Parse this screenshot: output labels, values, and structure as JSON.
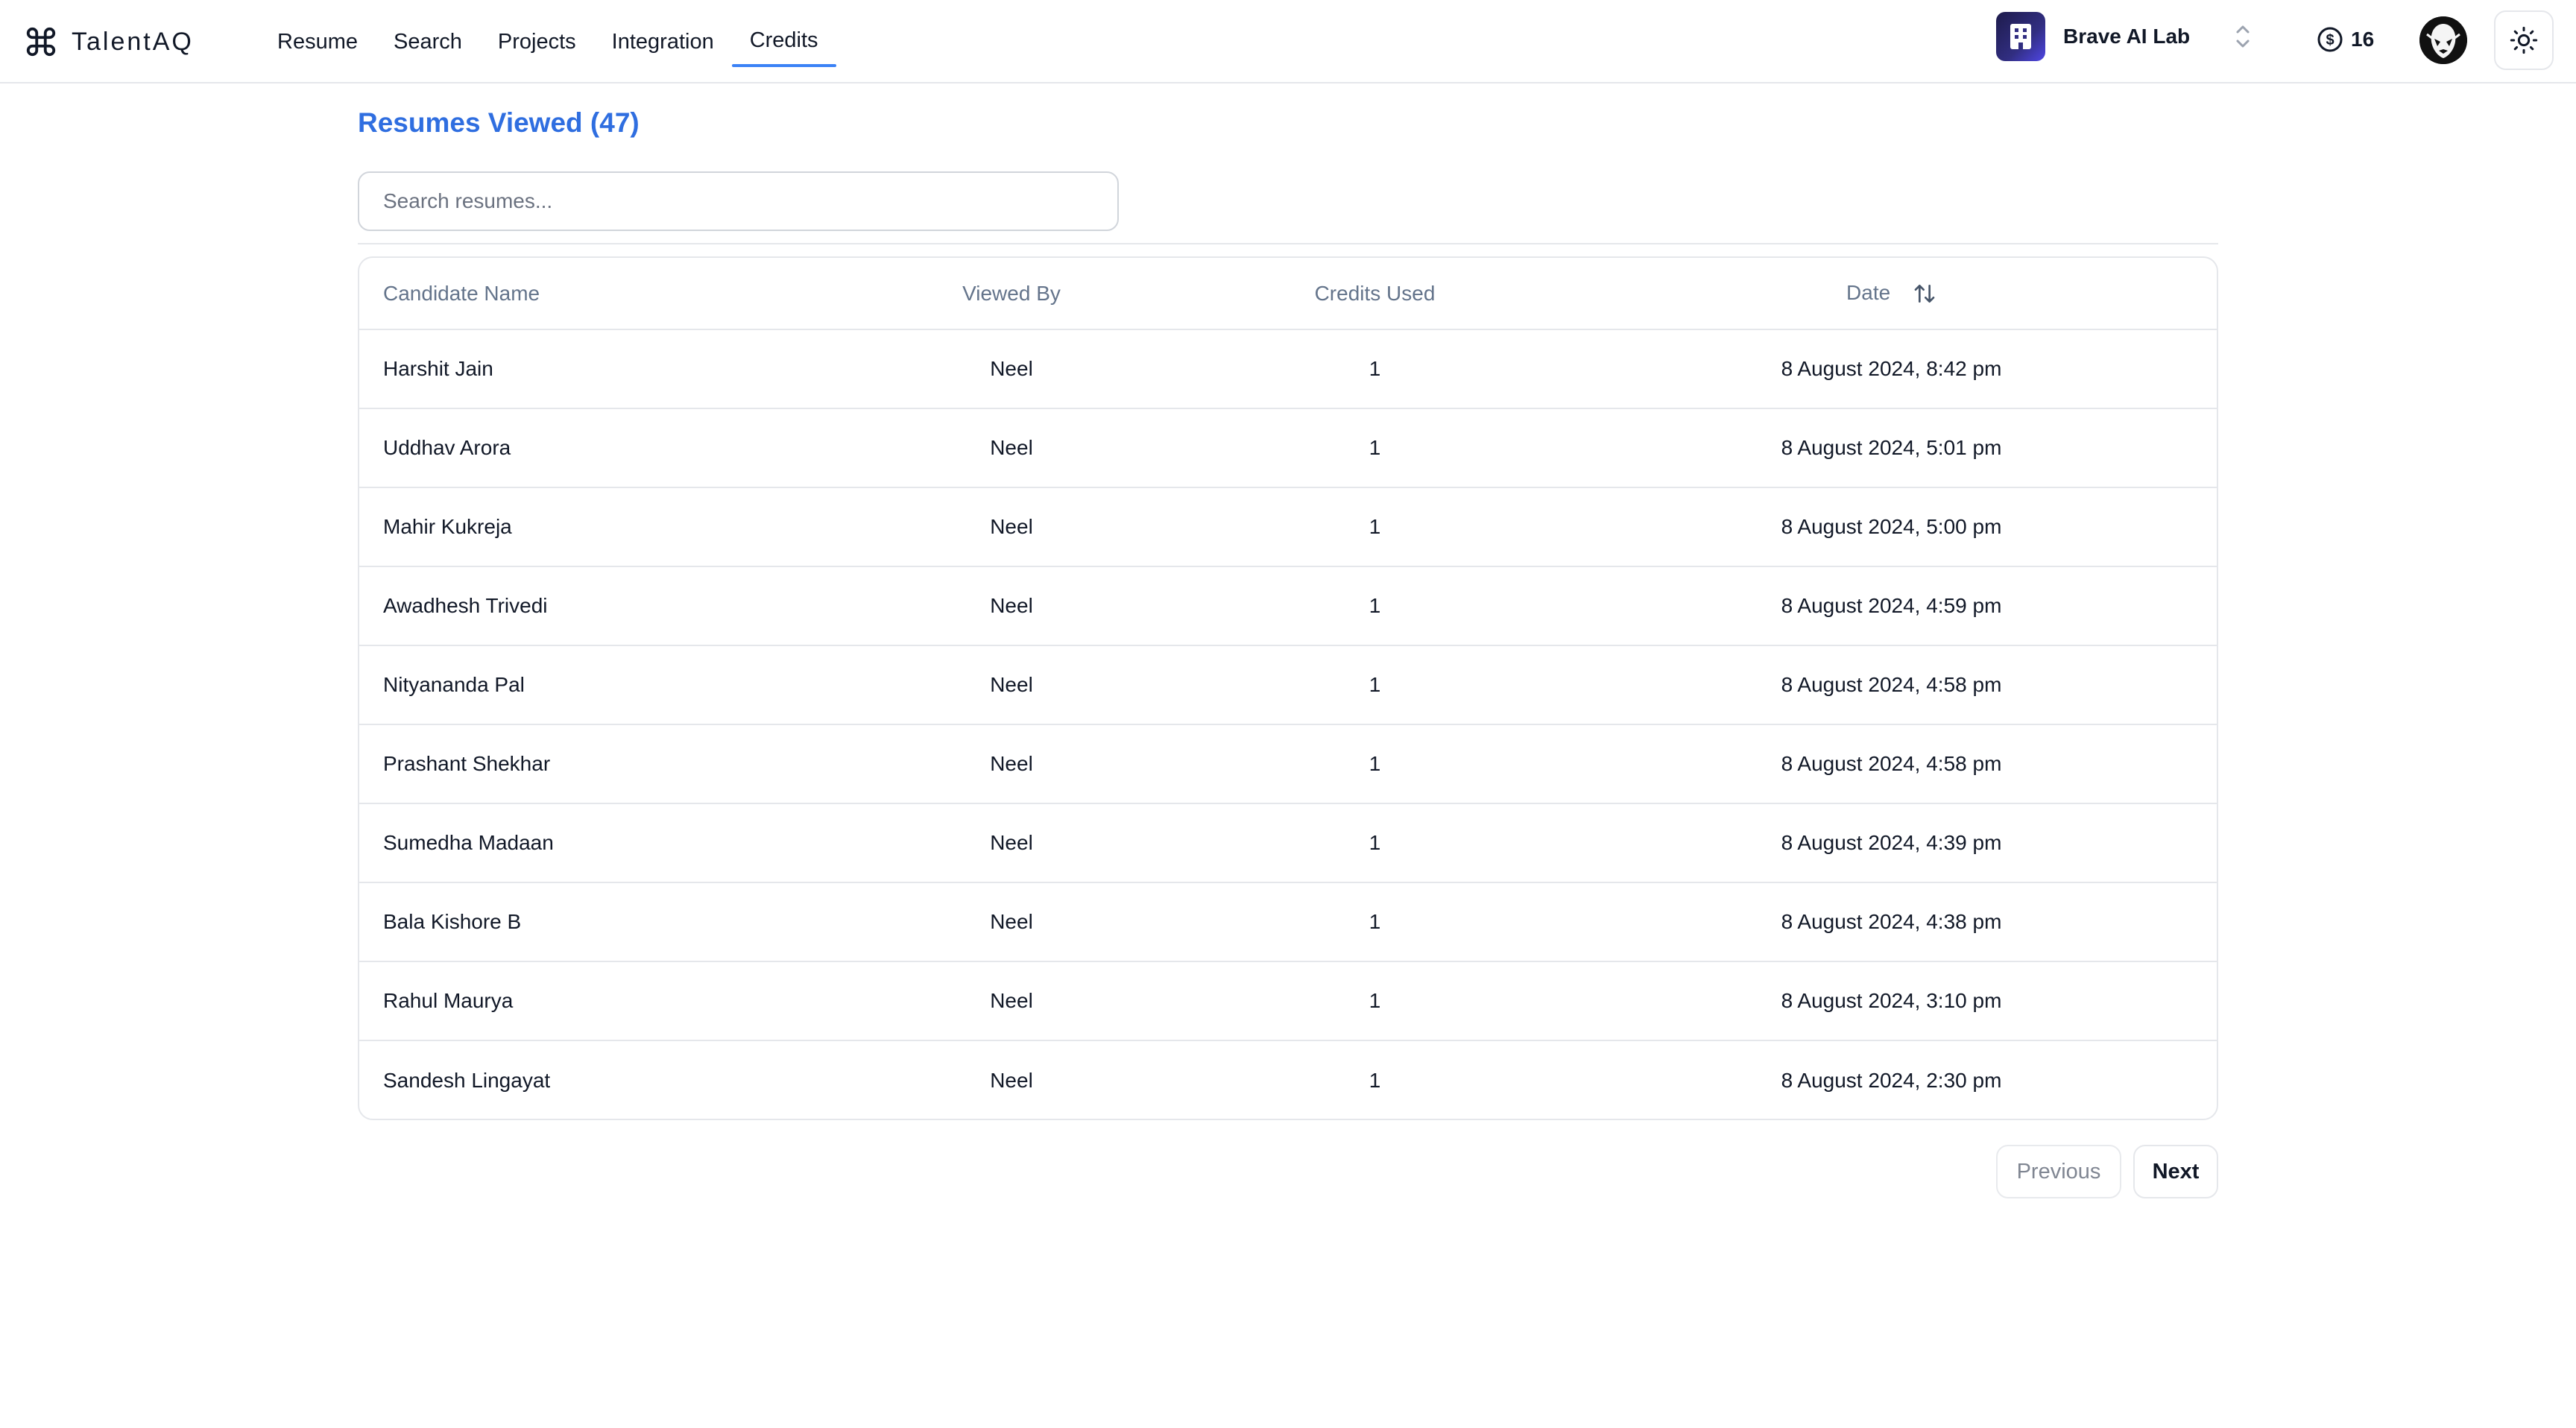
{
  "app": {
    "name": "TalentAQ"
  },
  "nav": {
    "items": [
      {
        "label": "Resume"
      },
      {
        "label": "Search"
      },
      {
        "label": "Projects"
      },
      {
        "label": "Integration"
      },
      {
        "label": "Credits",
        "active": true
      }
    ]
  },
  "workspace": {
    "name": "Brave AI Lab"
  },
  "credits": {
    "balance": "16"
  },
  "page": {
    "title": "Resumes Viewed (47)"
  },
  "search": {
    "placeholder": "Search resumes...",
    "value": ""
  },
  "table": {
    "columns": [
      "Candidate Name",
      "Viewed By",
      "Credits Used",
      "Date"
    ],
    "rows": [
      {
        "name": "Harshit Jain",
        "viewed_by": "Neel",
        "credits": "1",
        "date": "8 August 2024, 8:42 pm"
      },
      {
        "name": "Uddhav Arora",
        "viewed_by": "Neel",
        "credits": "1",
        "date": "8 August 2024, 5:01 pm"
      },
      {
        "name": "Mahir Kukreja",
        "viewed_by": "Neel",
        "credits": "1",
        "date": "8 August 2024, 5:00 pm"
      },
      {
        "name": "Awadhesh Trivedi",
        "viewed_by": "Neel",
        "credits": "1",
        "date": "8 August 2024, 4:59 pm"
      },
      {
        "name": "Nityananda Pal",
        "viewed_by": "Neel",
        "credits": "1",
        "date": "8 August 2024, 4:58 pm"
      },
      {
        "name": "Prashant Shekhar",
        "viewed_by": "Neel",
        "credits": "1",
        "date": "8 August 2024, 4:58 pm"
      },
      {
        "name": "Sumedha Madaan",
        "viewed_by": "Neel",
        "credits": "1",
        "date": "8 August 2024, 4:39 pm"
      },
      {
        "name": "Bala Kishore B",
        "viewed_by": "Neel",
        "credits": "1",
        "date": "8 August 2024, 4:38 pm"
      },
      {
        "name": "Rahul Maurya",
        "viewed_by": "Neel",
        "credits": "1",
        "date": "8 August 2024, 3:10 pm"
      },
      {
        "name": "Sandesh Lingayat",
        "viewed_by": "Neel",
        "credits": "1",
        "date": "8 August 2024, 2:30 pm"
      }
    ]
  },
  "pagination": {
    "previous_label": "Previous",
    "next_label": "Next"
  },
  "colors": {
    "accent": "#2f6ee0",
    "tab_underline": "#3b82f6",
    "border": "#e5e7eb",
    "muted_text": "#64748b"
  },
  "icons": {
    "brand": "command-icon",
    "workspace": "building-icon",
    "workspace_switcher": "chevrons-up-down-icon",
    "credits": "dollar-circle-icon",
    "theme": "sun-icon",
    "sort": "sort-arrows-icon"
  }
}
